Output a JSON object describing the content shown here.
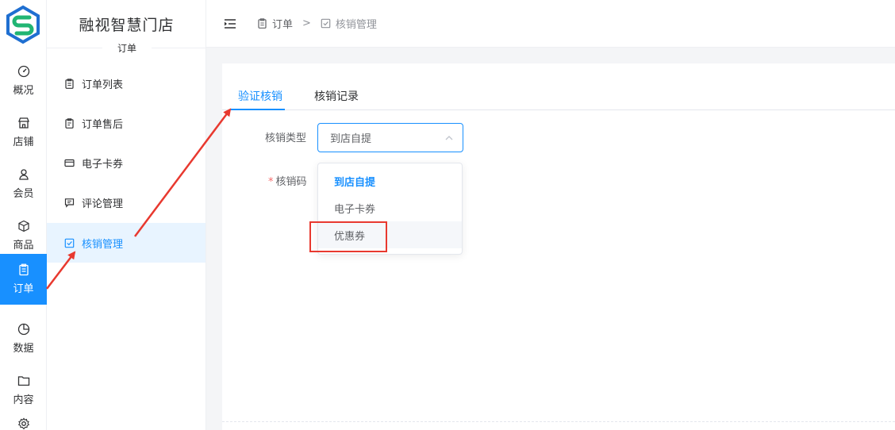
{
  "brand": {
    "store_name": "融视智慧门店",
    "logo_colors": [
      "#1f6fd1",
      "#21b573"
    ]
  },
  "rail": {
    "items": [
      {
        "label": "概况",
        "icon": "dashboard-icon"
      },
      {
        "label": "店铺",
        "icon": "store-icon"
      },
      {
        "label": "会员",
        "icon": "user-icon"
      },
      {
        "label": "商品",
        "icon": "box-icon"
      },
      {
        "label": "订单",
        "icon": "clipboard-icon",
        "active": true
      },
      {
        "label": "数据",
        "icon": "pie-chart-icon"
      },
      {
        "label": "内容",
        "icon": "folder-icon"
      },
      {
        "label": "",
        "icon": "gear-icon"
      }
    ]
  },
  "sidebar": {
    "section_title": "订单",
    "items": [
      {
        "label": "订单列表",
        "icon": "clipboard-icon"
      },
      {
        "label": "订单售后",
        "icon": "clipboard-icon"
      },
      {
        "label": "电子卡券",
        "icon": "card-icon"
      },
      {
        "label": "评论管理",
        "icon": "comment-icon"
      },
      {
        "label": "核销管理",
        "icon": "checkbox-icon",
        "active": true
      }
    ]
  },
  "header": {
    "breadcrumb": [
      {
        "label": "订单",
        "icon": "clipboard-icon"
      },
      {
        "label": "核销管理",
        "icon": "checkbox-icon"
      }
    ],
    "separator": ">"
  },
  "main": {
    "tabs": [
      {
        "label": "验证核销",
        "active": true
      },
      {
        "label": "核销记录",
        "active": false
      }
    ],
    "form": {
      "type_label": "核销类型",
      "type_value": "到店自提",
      "code_label": "核销码",
      "code_required_mark": "*"
    },
    "dropdown": {
      "options": [
        "到店自提",
        "电子卡券",
        "优惠券"
      ],
      "selected": "到店自提",
      "hovered": "优惠券"
    }
  },
  "colors": {
    "accent": "#1890ff",
    "annotation": "#e8392f",
    "required": "#f56c6c"
  }
}
